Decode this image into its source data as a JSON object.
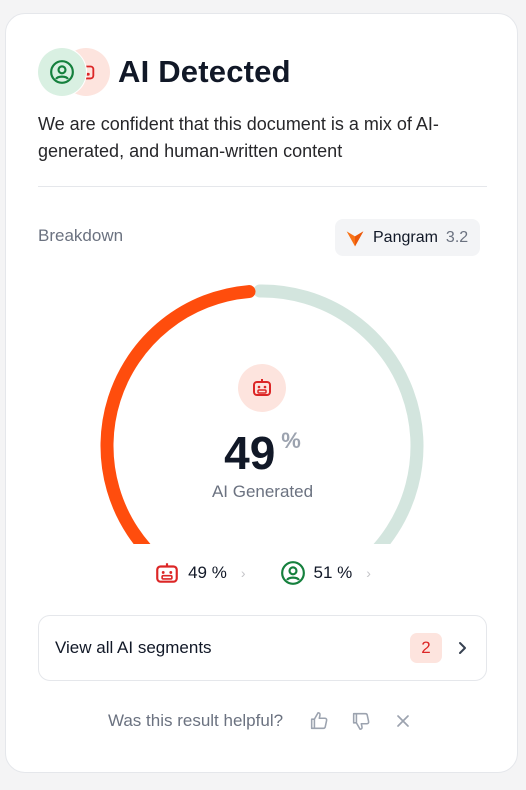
{
  "header": {
    "title": "AI Detected",
    "description": "We are confident that this document is a mix of AI-generated, and human-written content"
  },
  "breakdown": {
    "label": "Breakdown",
    "model_name": "Pangram",
    "model_version": "3.2"
  },
  "gauge": {
    "ai_percent": 49,
    "percent_sign": "%",
    "label": "AI Generated",
    "ai_color": "#ff4d0d",
    "human_color": "#d3e5de"
  },
  "stats": {
    "ai": "49 %",
    "human": "51 %"
  },
  "segments": {
    "label": "View all AI segments",
    "count": "2"
  },
  "feedback": {
    "question": "Was this result helpful?"
  }
}
